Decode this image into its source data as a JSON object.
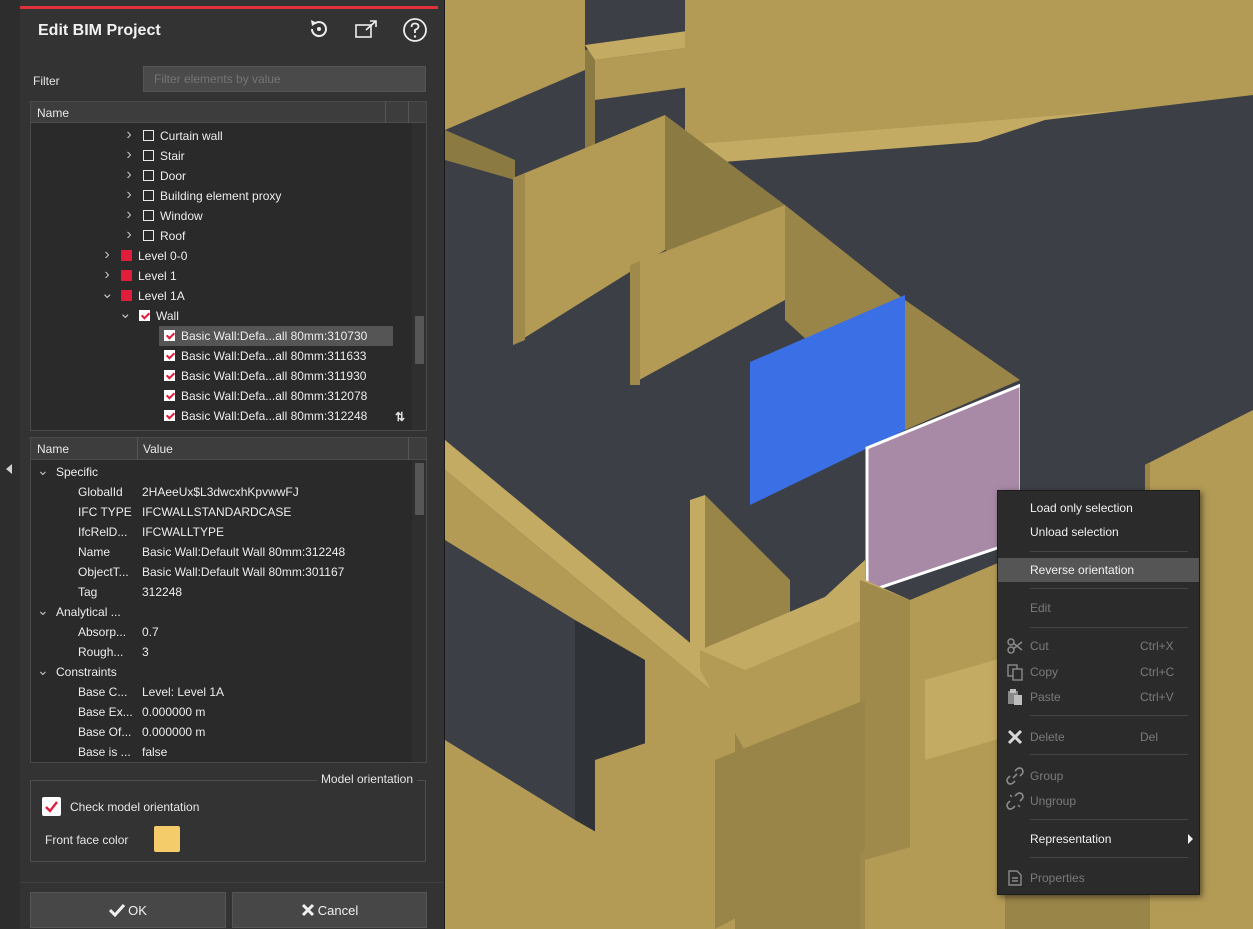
{
  "panel": {
    "title": "Edit BIM Project",
    "header_icons": [
      "reset-icon",
      "export-icon",
      "help-icon"
    ],
    "filter": {
      "label": "Filter",
      "placeholder": "Filter elements by value",
      "value": ""
    },
    "tree": {
      "column": "Name",
      "items": [
        {
          "label": "Curtain wall",
          "state": "unchecked",
          "expander": "collapsed"
        },
        {
          "label": "Stair",
          "state": "unchecked",
          "expander": "collapsed"
        },
        {
          "label": "Door",
          "state": "unchecked",
          "expander": "collapsed"
        },
        {
          "label": "Building element proxy",
          "state": "unchecked",
          "expander": "collapsed"
        },
        {
          "label": "Window",
          "state": "unchecked",
          "expander": "collapsed"
        },
        {
          "label": "Roof",
          "state": "unchecked",
          "expander": "collapsed"
        },
        {
          "label": "Level 0-0",
          "state": "partial",
          "expander": "collapsed"
        },
        {
          "label": "Level 1",
          "state": "partial",
          "expander": "collapsed"
        },
        {
          "label": "Level 1A",
          "state": "partial",
          "expander": "expanded"
        },
        {
          "label": "Wall",
          "state": "checked",
          "expander": "expanded"
        },
        {
          "label": "Basic Wall:Defa...all 80mm:310730",
          "state": "checked",
          "selected": true
        },
        {
          "label": "Basic Wall:Defa...all 80mm:311633",
          "state": "checked"
        },
        {
          "label": "Basic Wall:Defa...all 80mm:311930",
          "state": "checked"
        },
        {
          "label": "Basic Wall:Defa...all 80mm:312078",
          "state": "checked"
        },
        {
          "label": "Basic Wall:Defa...all 80mm:312248",
          "state": "checked"
        }
      ]
    },
    "properties": {
      "col_name": "Name",
      "col_value": "Value",
      "groups": [
        {
          "name": "Specific",
          "rows": [
            {
              "name": "GlobalId",
              "value": "2HAeeUx$L3dwcxhKpvwwFJ"
            },
            {
              "name": "IFC TYPE",
              "value": "IFCWALLSTANDARDCASE"
            },
            {
              "name": "IfcRelD...",
              "value": "IFCWALLTYPE"
            },
            {
              "name": "Name",
              "value": "Basic Wall:Default Wall 80mm:312248"
            },
            {
              "name": "ObjectT...",
              "value": "Basic Wall:Default Wall 80mm:301167"
            },
            {
              "name": "Tag",
              "value": "312248"
            }
          ]
        },
        {
          "name": "Analytical ...",
          "rows": [
            {
              "name": "Absorp...",
              "value": "0.7"
            },
            {
              "name": "Rough...",
              "value": "3"
            }
          ]
        },
        {
          "name": "Constraints",
          "rows": [
            {
              "name": "Base C...",
              "value": "Level: Level 1A"
            },
            {
              "name": "Base Ex...",
              "value": "0.000000 m"
            },
            {
              "name": "Base Of...",
              "value": "0.000000 m"
            },
            {
              "name": "Base is ...",
              "value": "false"
            }
          ]
        }
      ]
    },
    "model_orientation": {
      "title": "Model orientation",
      "check_label": "Check model orientation",
      "checked": true,
      "front_face_label": "Front face color",
      "front_face_color": "#f5cc6a"
    },
    "buttons": {
      "ok": "OK",
      "cancel": "Cancel"
    }
  },
  "context_menu": {
    "items": [
      {
        "label": "Load only selection",
        "enabled": true
      },
      {
        "label": "Unload selection",
        "enabled": true
      },
      {
        "label": "Reverse orientation",
        "enabled": true,
        "highlighted": true
      },
      {
        "label": "Edit",
        "enabled": false
      },
      {
        "label": "Cut",
        "shortcut": "Ctrl+X",
        "icon": "scissors-icon",
        "enabled": false
      },
      {
        "label": "Copy",
        "shortcut": "Ctrl+C",
        "icon": "copy-icon",
        "enabled": false
      },
      {
        "label": "Paste",
        "shortcut": "Ctrl+V",
        "icon": "paste-icon",
        "enabled": false
      },
      {
        "label": "Delete",
        "shortcut": "Del",
        "icon": "delete-icon",
        "enabled": false
      },
      {
        "label": "Group",
        "icon": "link-icon",
        "enabled": false
      },
      {
        "label": "Ungroup",
        "icon": "unlink-icon",
        "enabled": false
      },
      {
        "label": "Representation",
        "enabled": true,
        "submenu": true
      },
      {
        "label": "Properties",
        "icon": "properties-icon",
        "enabled": false
      }
    ]
  },
  "colors": {
    "accent": "#e01e3c",
    "wall": "#b39b55",
    "floor": "#3c3f45",
    "selected_wall": "#3a6fe6",
    "highlighted_wall": "#a88aa6",
    "menu_highlight": "#555555"
  }
}
